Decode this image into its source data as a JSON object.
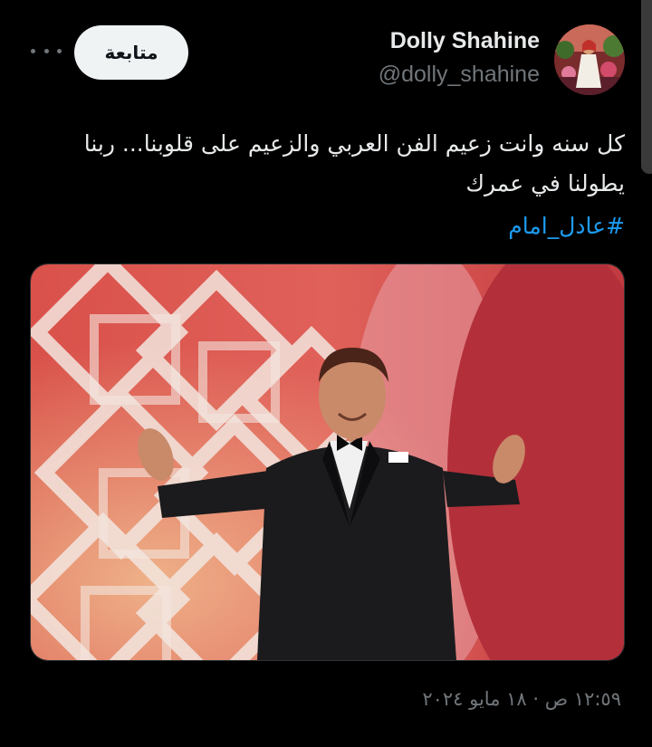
{
  "profile": {
    "display_name": "Dolly Shahine",
    "handle": "@dolly_shahine",
    "follow_label": "متابعة"
  },
  "tweet": {
    "text": "كل سنه وانت زعيم الفن العربي والزعيم على قلوبنا... ربنا يطولنا في عمرك",
    "hashtag": "#عادل_امام",
    "timestamp": "١٢:٥٩ ص · ١٨ مايو ٢٠٢٤"
  },
  "icons": {
    "more": "more-horizontal-icon"
  },
  "colors": {
    "background": "#000000",
    "text": "#e7e9ea",
    "muted": "#71767b",
    "link": "#1d9bf0",
    "button_bg": "#eff3f4"
  }
}
